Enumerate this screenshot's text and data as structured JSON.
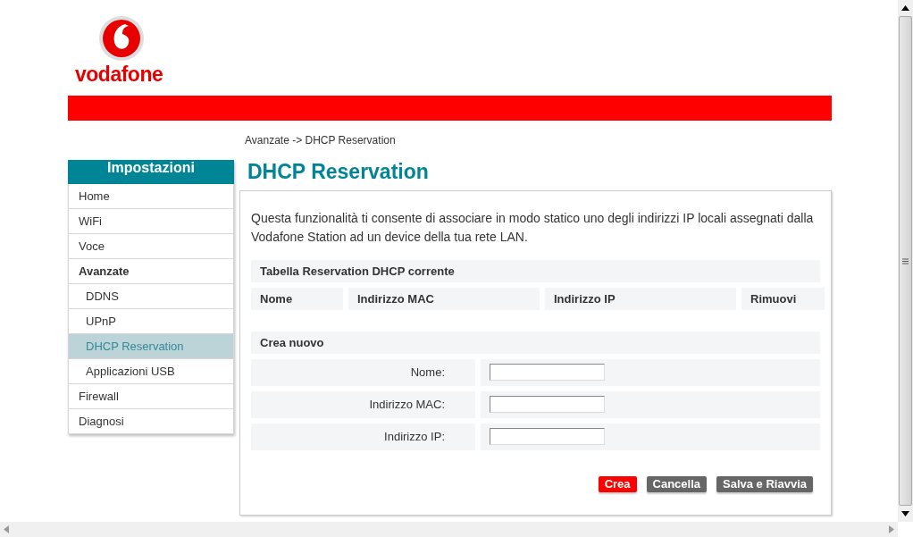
{
  "logo": {
    "text": "vodafone"
  },
  "breadcrumb": "Avanzate -> DHCP Reservation",
  "sidebar": {
    "title": "Impostazioni",
    "items": [
      {
        "label": "Home",
        "kind": "item",
        "selected": false
      },
      {
        "label": "WiFi",
        "kind": "item",
        "selected": false
      },
      {
        "label": "Voce",
        "kind": "item",
        "selected": false
      },
      {
        "label": "Avanzate",
        "kind": "section",
        "selected": false
      },
      {
        "label": "DDNS",
        "kind": "subitem",
        "selected": false
      },
      {
        "label": "UPnP",
        "kind": "subitem",
        "selected": false
      },
      {
        "label": "DHCP Reservation",
        "kind": "subitem",
        "selected": true
      },
      {
        "label": "Applicazioni USB",
        "kind": "subitem",
        "selected": false
      },
      {
        "label": "Firewall",
        "kind": "item",
        "selected": false
      },
      {
        "label": "Diagnosi",
        "kind": "item",
        "selected": false
      }
    ]
  },
  "page_title": "DHCP Reservation",
  "description": "Questa funzionalità ti consente di associare in modo statico uno degli indirizzi IP locali assegnati dalla Vodafone Station ad un device della tua rete LAN.",
  "table": {
    "title": "Tabella Reservation DHCP corrente",
    "columns": [
      "Nome",
      "Indirizzo MAC",
      "Indirizzo IP",
      "Rimuovi"
    ]
  },
  "create": {
    "title": "Crea nuovo",
    "fields": [
      {
        "label": "Nome:"
      },
      {
        "label": "Indirizzo MAC:"
      },
      {
        "label": "Indirizzo IP:"
      }
    ]
  },
  "buttons": [
    {
      "label": "Crea",
      "kind": "primary"
    },
    {
      "label": "Cancella",
      "kind": "secondary"
    },
    {
      "label": "Salva e Riavvia",
      "kind": "secondary"
    }
  ]
}
